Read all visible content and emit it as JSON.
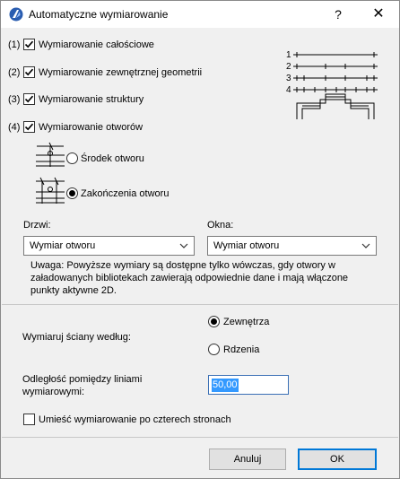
{
  "window": {
    "title": "Automatyczne wymiarowanie",
    "help_glyph": "?",
    "close_glyph": "✕"
  },
  "options": [
    {
      "prefix": "(1)",
      "label": "Wymiarowanie całościowe",
      "checked": true
    },
    {
      "prefix": "(2)",
      "label": "Wymiarowanie zewnętrznej geometrii",
      "checked": true
    },
    {
      "prefix": "(3)",
      "label": "Wymiarowanie struktury",
      "checked": true
    },
    {
      "prefix": "(4)",
      "label": "Wymiarowanie otworów",
      "checked": true
    }
  ],
  "opening_mode": {
    "center_label": "Środek otworu",
    "ends_label": "Zakończenia otworu",
    "selected": "ends"
  },
  "preview": {
    "line_labels": [
      "1",
      "2",
      "3",
      "4"
    ]
  },
  "doors": {
    "label": "Drzwi:",
    "value": "Wymiar otworu"
  },
  "windows": {
    "label": "Okna:",
    "value": "Wymiar otworu"
  },
  "note": "Uwaga: Powyższe wymiary są dostępne tylko wówczas, gdy otwory w załadowanych bibliotekach zawierają odpowiednie dane i mają włączone punkty aktywne 2D.",
  "wall_dim": {
    "label": "Wymiaruj ściany według:",
    "outer_label": "Zewnętrza",
    "core_label": "Rdzenia",
    "selected": "outer"
  },
  "distance": {
    "label_line1": "Odległość pomiędzy liniami",
    "label_line2": "wymiarowymi:",
    "value": "50,00"
  },
  "four_sides": {
    "label": "Umieść wymiarowanie po czterech stronach",
    "checked": false
  },
  "buttons": {
    "cancel": "Anuluj",
    "ok": "OK"
  }
}
